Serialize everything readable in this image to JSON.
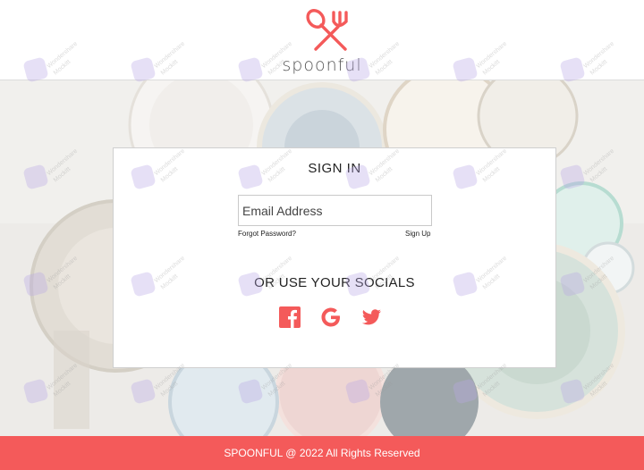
{
  "brand": {
    "name": "spoonful",
    "accent_color": "#f45a5a",
    "logo_icon": "fork-and-spoon-icon"
  },
  "signin": {
    "title": "SIGN IN",
    "email_placeholder": "Email Address",
    "forgot_label": "Forgot Password?",
    "signup_label": "Sign Up"
  },
  "socials": {
    "title": "OR USE YOUR SOCIALS",
    "items": [
      {
        "name": "facebook",
        "icon": "facebook-icon"
      },
      {
        "name": "google",
        "icon": "google-icon"
      },
      {
        "name": "twitter",
        "icon": "twitter-icon"
      }
    ]
  },
  "footer": {
    "text": "SPOONFUL @ 2022 All Rights Reserved"
  },
  "watermark": {
    "line1": "Wondershare",
    "line2": "Mockitt"
  }
}
